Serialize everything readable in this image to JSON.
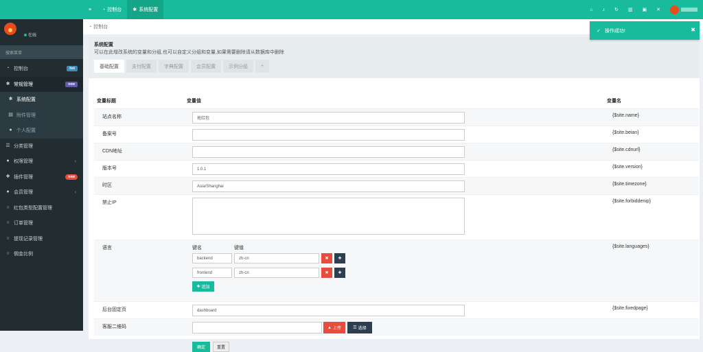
{
  "sidebar": {
    "status": "在线",
    "search_placeholder": "搜索菜单",
    "items": [
      {
        "label": "控制台",
        "badge": "hot",
        "badge_color": "#3c8dbc"
      },
      {
        "label": "常规管理",
        "badge": "new",
        "badge_color": "#605ca8"
      },
      {
        "label": "系统配置"
      },
      {
        "label": "附件管理"
      },
      {
        "label": "个人配置"
      },
      {
        "label": "分类管理"
      },
      {
        "label": "权限管理"
      },
      {
        "label": "插件管理",
        "badge": "new",
        "badge_color": "#e74c3c"
      },
      {
        "label": "会员管理"
      },
      {
        "label": "红包类型配置管理"
      },
      {
        "label": "订单管理"
      },
      {
        "label": "提现记录管理"
      },
      {
        "label": "佣金比例"
      }
    ]
  },
  "topbar": {
    "menu_icon": "bars-icon",
    "tabs": [
      {
        "label": "控制台",
        "icon": "dashboard-icon"
      },
      {
        "label": "系统配置",
        "icon": "gear-icon"
      }
    ],
    "right_icons": [
      "home-icon",
      "bell-icon",
      "refresh-icon",
      "trash-icon",
      "language-icon",
      "fullscreen-icon"
    ]
  },
  "breadcrumb": {
    "label": "控制台"
  },
  "panel": {
    "title": "系统配置",
    "desc": "可以在此增改系统的变量和分组,也可以自定义分组和变量,如果需要删除请从数据库中删除",
    "tabs": [
      "基础配置",
      "支付配置",
      "字典配置",
      "会员配置",
      "示例分组",
      "+"
    ],
    "columns": {
      "title": "变量标题",
      "value": "变量值",
      "name": "变量名"
    },
    "rows": [
      {
        "label": "站点名称",
        "value": "抢红包",
        "var": "{$site.name}"
      },
      {
        "label": "备案号",
        "value": "",
        "var": "{$site.beian}"
      },
      {
        "label": "CDN地址",
        "value": "",
        "var": "{$site.cdnurl}"
      },
      {
        "label": "版本号",
        "value": "1.0.1",
        "var": "{$site.version}"
      },
      {
        "label": "时区",
        "value": "Asia/Shanghai",
        "var": "{$site.timezone}"
      },
      {
        "label": "禁止IP",
        "value": "",
        "var": "{$site.forbiddenip}"
      }
    ],
    "languages": {
      "label": "语言",
      "key_header": "键名",
      "val_header": "键值",
      "pairs": [
        {
          "key": "backend",
          "value": "zh-cn"
        },
        {
          "key": "frontend",
          "value": "zh-cn"
        }
      ],
      "add_label": "追加",
      "var": "{$site.languages}"
    },
    "fixedpage": {
      "label": "后台固定页",
      "value": "dashboard",
      "var": "{$site.fixedpage}"
    },
    "qrcode": {
      "label": "客服二维码",
      "upload_label": "上传",
      "choose_label": "选择"
    },
    "submit_label": "确定",
    "reset_label": "重置"
  },
  "toast": {
    "message": "操作成功!"
  }
}
